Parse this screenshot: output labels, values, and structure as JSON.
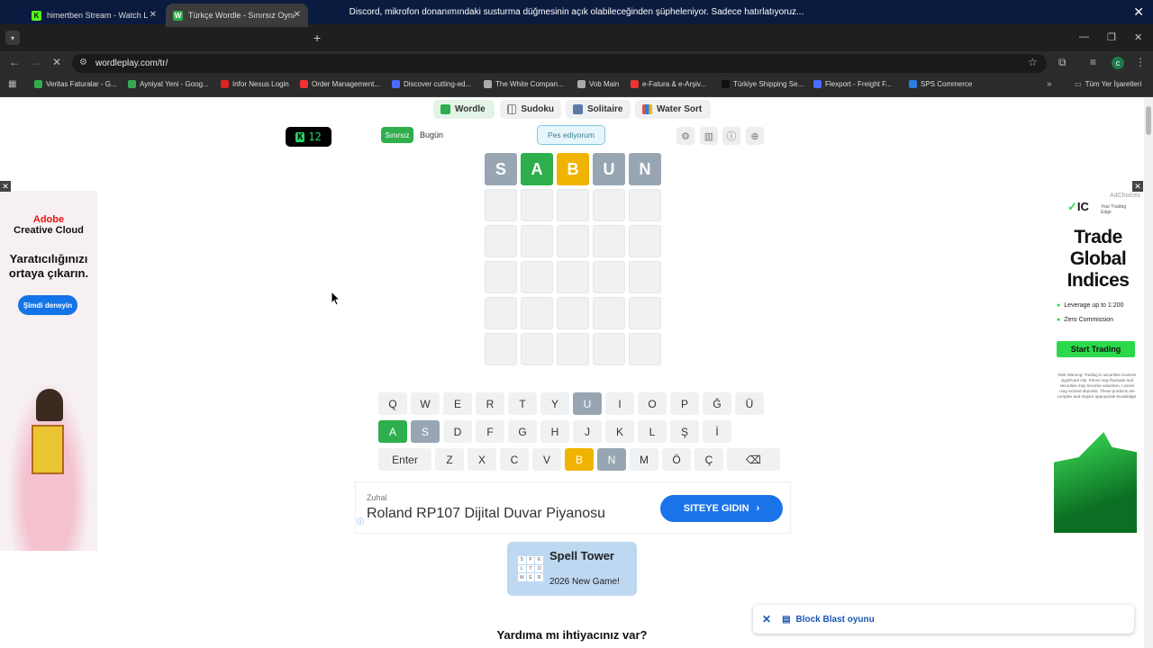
{
  "notification": {
    "text": "Discord, mikrofon donanımındaki susturma düğmesinin açık olabileceğinden şüpheleniyor. Sadece hatırlatıyoruz...",
    "close": "✕"
  },
  "browser": {
    "tabs": [
      {
        "title": "himertben Stream - Watch Live",
        "favicon": "kick-icon",
        "fav_letter": "K"
      },
      {
        "title": "Türkçe Wordle - Sınırsız Oyna",
        "favicon": "wordle-icon",
        "fav_letter": "W"
      }
    ],
    "url": "wordleplay.com/tr/",
    "profile_letter": "c",
    "bookmarks": [
      {
        "label": "Veritas Faturalar - G...",
        "color": "#2eae4c"
      },
      {
        "label": "Ayniyat Yeni - Goog...",
        "color": "#34a853"
      },
      {
        "label": "Infor Nexus Login",
        "color": "#d22"
      },
      {
        "label": "Order Management...",
        "color": "#e33"
      },
      {
        "label": "Discover cutting-ed...",
        "color": "#4a6cff"
      },
      {
        "label": "The White Compan...",
        "color": "#aaa"
      },
      {
        "label": "Vob Main",
        "color": "#aaa"
      },
      {
        "label": "e-Fatura & e-Arşiv...",
        "color": "#e33"
      },
      {
        "label": "Türkiye Shipping Se...",
        "color": "#111"
      },
      {
        "label": "Flexport - Freight F...",
        "color": "#4a6cff"
      },
      {
        "label": "SPS Commerce",
        "color": "#2a7de1"
      }
    ],
    "all_bookmarks": "Tüm Yer İşaretleri"
  },
  "nav": [
    {
      "label": "Wordle",
      "color": "#2eae4c"
    },
    {
      "label": "Sudoku",
      "color": "#888"
    },
    {
      "label": "Solitaire",
      "color": "#5a7aa8"
    },
    {
      "label": "Water Sort",
      "color": "#d9534f"
    }
  ],
  "game": {
    "streak": "12",
    "streak_icon": "K",
    "mode": "Sınırsız",
    "today": "Bugün",
    "give_up": "Pes ediyorum",
    "board": [
      [
        {
          "l": "S",
          "s": "absent"
        },
        {
          "l": "A",
          "s": "correct"
        },
        {
          "l": "B",
          "s": "present"
        },
        {
          "l": "U",
          "s": "absent"
        },
        {
          "l": "N",
          "s": "absent"
        }
      ],
      [
        {
          "l": "",
          "s": "empty"
        },
        {
          "l": "",
          "s": "empty"
        },
        {
          "l": "",
          "s": "empty"
        },
        {
          "l": "",
          "s": "empty"
        },
        {
          "l": "",
          "s": "empty"
        }
      ],
      [
        {
          "l": "",
          "s": "empty"
        },
        {
          "l": "",
          "s": "empty"
        },
        {
          "l": "",
          "s": "empty"
        },
        {
          "l": "",
          "s": "empty"
        },
        {
          "l": "",
          "s": "empty"
        }
      ],
      [
        {
          "l": "",
          "s": "empty"
        },
        {
          "l": "",
          "s": "empty"
        },
        {
          "l": "",
          "s": "empty"
        },
        {
          "l": "",
          "s": "empty"
        },
        {
          "l": "",
          "s": "empty"
        }
      ],
      [
        {
          "l": "",
          "s": "empty"
        },
        {
          "l": "",
          "s": "empty"
        },
        {
          "l": "",
          "s": "empty"
        },
        {
          "l": "",
          "s": "empty"
        },
        {
          "l": "",
          "s": "empty"
        }
      ],
      [
        {
          "l": "",
          "s": "empty"
        },
        {
          "l": "",
          "s": "empty"
        },
        {
          "l": "",
          "s": "empty"
        },
        {
          "l": "",
          "s": "empty"
        },
        {
          "l": "",
          "s": "empty"
        }
      ]
    ],
    "keyboard": [
      [
        {
          "k": "Q"
        },
        {
          "k": "W"
        },
        {
          "k": "E"
        },
        {
          "k": "R"
        },
        {
          "k": "T"
        },
        {
          "k": "Y"
        },
        {
          "k": "U",
          "s": "absent"
        },
        {
          "k": "I"
        },
        {
          "k": "O"
        },
        {
          "k": "P"
        },
        {
          "k": "Ğ"
        },
        {
          "k": "Ü"
        }
      ],
      [
        {
          "k": "A",
          "s": "correct"
        },
        {
          "k": "S",
          "s": "absent"
        },
        {
          "k": "D"
        },
        {
          "k": "F"
        },
        {
          "k": "G"
        },
        {
          "k": "H"
        },
        {
          "k": "J"
        },
        {
          "k": "K"
        },
        {
          "k": "L"
        },
        {
          "k": "Ş"
        },
        {
          "k": "İ"
        }
      ],
      [
        {
          "k": "Enter",
          "wide": true
        },
        {
          "k": "Z"
        },
        {
          "k": "X"
        },
        {
          "k": "C"
        },
        {
          "k": "V"
        },
        {
          "k": "B",
          "s": "present"
        },
        {
          "k": "N",
          "s": "absent"
        },
        {
          "k": "M"
        },
        {
          "k": "Ö"
        },
        {
          "k": "Ç"
        },
        {
          "k": "⌫",
          "wide": true
        }
      ]
    ],
    "colors": {
      "correct": "#2eae4c",
      "present": "#f0b400",
      "absent": "#98a6b3"
    }
  },
  "ad_left": {
    "brand": "Adobe",
    "product": "Creative Cloud",
    "headline": "Yaratıcılığınızı ortaya çıkarın.",
    "cta": "Şimdi deneyin"
  },
  "ad_right": {
    "adchoices": "AdChoices",
    "brand": "IC",
    "tagline": "Your Trading Edge",
    "headline": "Trade Global Indices",
    "bullet1": "Leverage up to 1:200",
    "bullet2": "Zero Commission",
    "cta": "Start Trading",
    "disclaimer": "Risk Warning: Trading in securities involves significant risk. Prices may fluctuate and securities may become valueless. Losses may exceed deposits. These products are complex and require appropriate knowledge."
  },
  "banner": {
    "advertiser": "Zuhal",
    "title": "Roland RP107 Dijital Duvar Piyanosu",
    "cta": "SITEYE GIDIN"
  },
  "spell": {
    "title": "Spell Tower",
    "subtitle": "2026 New Game!",
    "tiles": [
      "S",
      "P",
      "E",
      "L",
      "T",
      "O",
      "W",
      "E",
      "R"
    ]
  },
  "help": "Yardıma mı ihtiyacınız var?",
  "blast": "Block Blast oyunu"
}
